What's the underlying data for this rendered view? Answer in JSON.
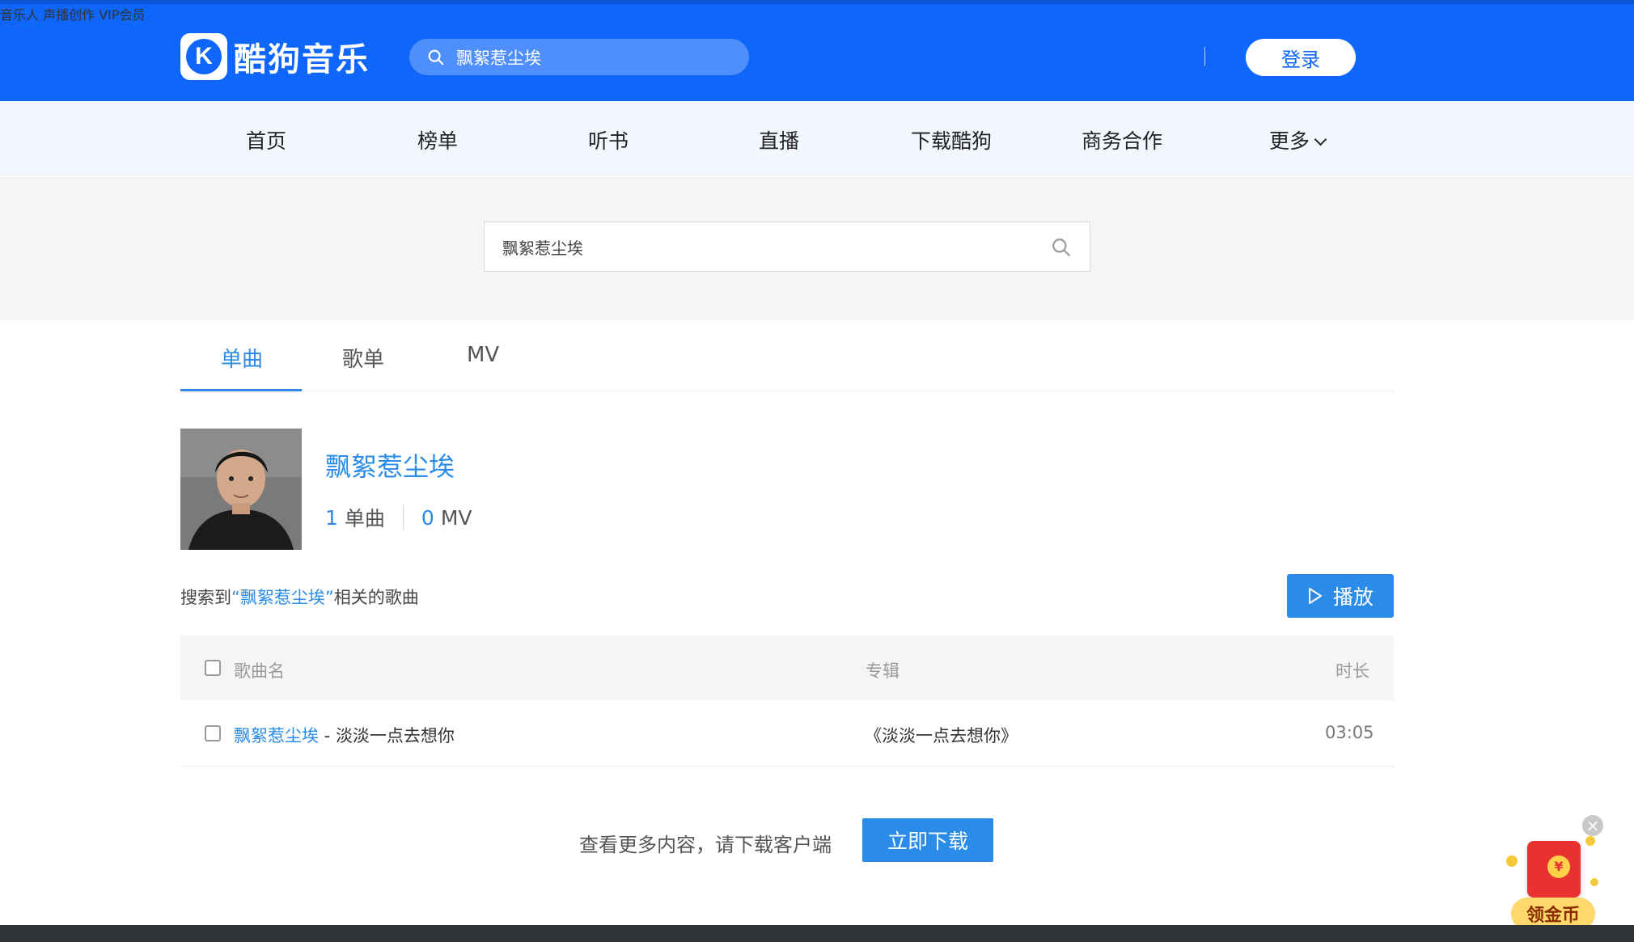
{
  "header": {
    "brand": "酷狗音乐",
    "logo_letter": "K",
    "search_value": "飘絮惹尘埃",
    "nav": [
      "音乐人",
      "声播创作",
      "VIP会员"
    ],
    "login_label": "登录"
  },
  "subnav": {
    "items": [
      "首页",
      "榜单",
      "听书",
      "直播",
      "下载酷狗",
      "商务合作",
      "更多"
    ]
  },
  "search": {
    "value": "飘絮惹尘埃"
  },
  "tabs": [
    "单曲",
    "歌单",
    "MV"
  ],
  "singer": {
    "name": "飘絮惹尘埃",
    "songs_count": "1",
    "songs_label": "单曲",
    "mv_count": "0",
    "mv_label": "MV"
  },
  "results": {
    "prefix": "搜索到",
    "keyword": "“飘絮惹尘埃”",
    "suffix": "相关的歌曲",
    "play_label": "播放"
  },
  "table": {
    "headers": {
      "name": "歌曲名",
      "album": "专辑",
      "duration": "时长"
    },
    "rows": [
      {
        "artist": "飘絮惹尘埃",
        "sep": " - ",
        "title": "淡淡一点去想你",
        "album": "《淡淡一点去想你》",
        "duration": "03:05"
      }
    ]
  },
  "download": {
    "text": "查看更多内容，请下载客户端",
    "button": "立即下载"
  },
  "float_widget": {
    "label": "领金币",
    "coin_symbol": "¥",
    "close": "×"
  },
  "colors": {
    "header_blue": "#0e66fb",
    "accent_blue": "#2a8ce8",
    "footer_dark": "#2f3338"
  }
}
